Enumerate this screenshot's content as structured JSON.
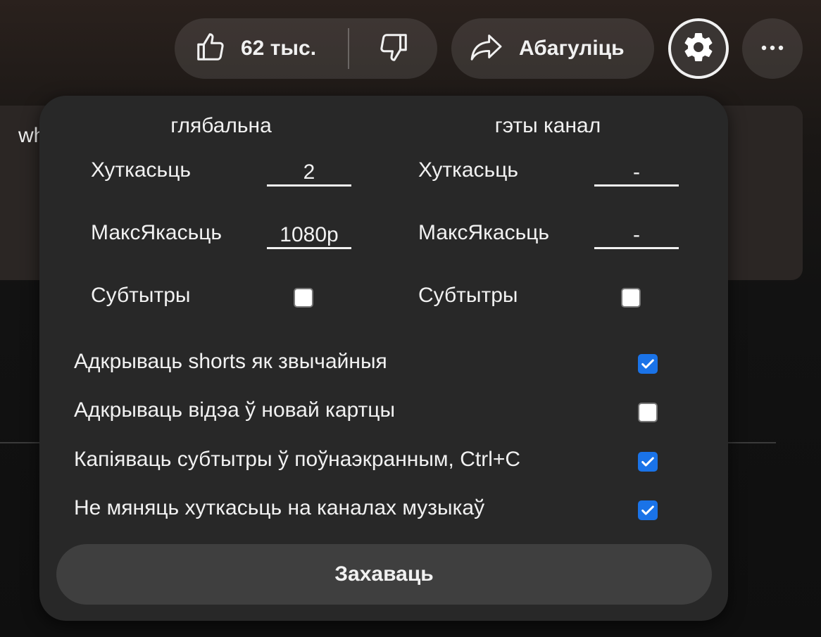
{
  "actions": {
    "like_count": "62 тыс.",
    "share_label": "Абагуліць"
  },
  "background": {
    "card_text_fragment": "who"
  },
  "settings": {
    "global": {
      "heading": "глябальна",
      "speed_label": "Хуткасьць",
      "speed_value": "2",
      "quality_label": "МаксЯкасьць",
      "quality_value": "1080p",
      "subtitles_label": "Субтытры",
      "subtitles_checked": false
    },
    "channel": {
      "heading": "гэты канал",
      "speed_label": "Хуткасьць",
      "speed_value": "-",
      "quality_label": "МаксЯкасьць",
      "quality_value": "-",
      "subtitles_label": "Субтытры",
      "subtitles_checked": false
    },
    "options": [
      {
        "label": "Адкрываць shorts як звычайныя",
        "checked": true
      },
      {
        "label": "Адкрываць відэа ў новай картцы",
        "checked": false
      },
      {
        "label": "Капіяваць субтытры ў поўнаэкранным, Ctrl+C",
        "checked": true
      },
      {
        "label": "Не мяняць хуткасьць на каналах музыкаў",
        "checked": true
      }
    ],
    "close_label": "Захаваць"
  },
  "colors": {
    "checkbox_on": "#1a73e8",
    "popup_bg": "#282828",
    "button_bg": "#3f3f3f"
  },
  "icons": [
    "thumbs-up-icon",
    "thumbs-down-icon",
    "share-icon",
    "gear-icon",
    "more-icon",
    "check-icon"
  ]
}
